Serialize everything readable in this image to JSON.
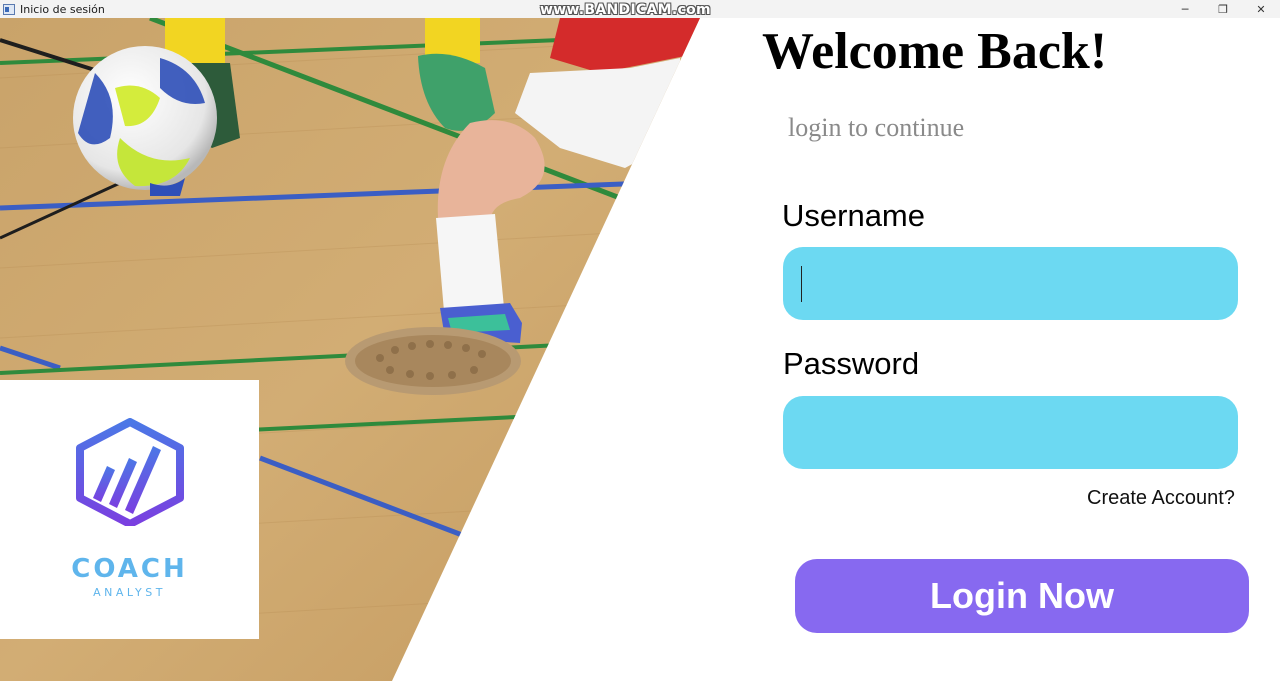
{
  "window": {
    "title": "Inicio de sesión",
    "watermark": "www.BANDICAM.com",
    "controls": {
      "minimize": "─",
      "restore": "❐",
      "close": "✕"
    }
  },
  "logo": {
    "title": "COACH",
    "subtitle": "ANALYST"
  },
  "form": {
    "heading": "Welcome Back!",
    "subheading": "login to continue",
    "username_label": "Username",
    "username_value": "",
    "password_label": "Password",
    "password_value": "",
    "create_account": "Create Account?",
    "login_button": "Login Now"
  },
  "colors": {
    "input_bg": "#6cd9f2",
    "button_bg": "#8769f0",
    "logo_text": "#5fb5ec",
    "logo_hex_top": "#4b78e6",
    "logo_hex_bottom": "#7a3fe0"
  }
}
